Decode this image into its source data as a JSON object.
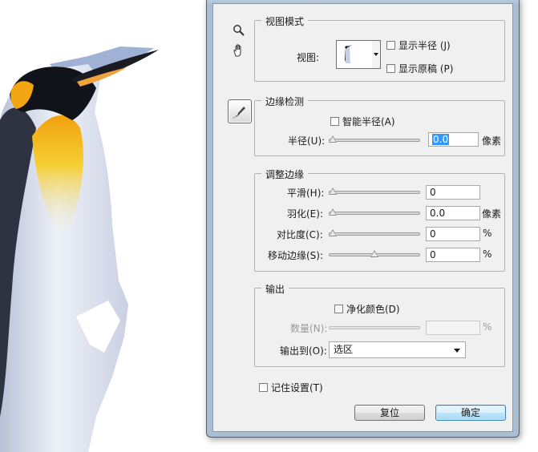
{
  "view_mode": {
    "title": "视图模式",
    "view_label": "视图:",
    "show_radius": "显示半径 (J)",
    "show_original": "显示原稿 (P)"
  },
  "edge_detection": {
    "title": "边缘检测",
    "smart_radius": "智能半径(A)",
    "radius_label": "半径(U):",
    "radius_value": "0.0",
    "radius_unit": "像素"
  },
  "adjust_edge": {
    "title": "调整边缘",
    "smooth_label": "平滑(H):",
    "smooth_value": "0",
    "feather_label": "羽化(E):",
    "feather_value": "0.0",
    "feather_unit": "像素",
    "contrast_label": "对比度(C):",
    "contrast_value": "0",
    "contrast_unit": "%",
    "shift_label": "移动边缘(S):",
    "shift_value": "0",
    "shift_unit": "%"
  },
  "output": {
    "title": "输出",
    "decontaminate": "净化颜色(D)",
    "amount_label": "数量(N):",
    "amount_unit": "%",
    "output_to_label": "输出到(O):",
    "output_to_value": "选区"
  },
  "remember_settings": "记住设置(T)",
  "buttons": {
    "reset": "复位",
    "ok": "确定"
  },
  "icons": {
    "zoom": "zoom-tool-icon",
    "hand": "hand-tool-icon",
    "refine": "refine-radius-brush-icon"
  },
  "colors": {
    "dialog_frame": "#a9bdd3",
    "client_bg": "#f0f0f0",
    "selection": "#3399ff",
    "ok_button": "#bee6fd"
  }
}
